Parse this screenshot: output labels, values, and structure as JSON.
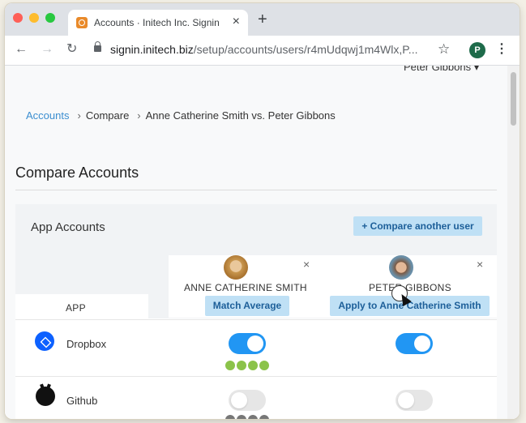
{
  "browser": {
    "tab_title": "Accounts · Initech Inc. Signin ·",
    "tab_close": "×",
    "new_tab": "+",
    "url_host": "signin.initech.biz",
    "url_path": "/setup/accounts/users/r4mUdqwj1m4Wlx,P...",
    "back": "←",
    "forward": "→",
    "reload": "↻",
    "bookmark": "☆",
    "profile_initial": "P",
    "menu": "⋮"
  },
  "header": {
    "user_menu": "Peter Gibbons ▾"
  },
  "breadcrumb": {
    "items": [
      "Accounts",
      "Compare",
      "Anne Catherine Smith vs. Peter Gibbons"
    ],
    "separator": "›"
  },
  "page": {
    "title": "Compare Accounts"
  },
  "panel": {
    "heading": "App Accounts",
    "compare_button": "+ Compare another user",
    "app_column_header": "APP"
  },
  "users": [
    {
      "name": "ANNE CATHERINE SMITH",
      "action": "Match Average",
      "remove": "×"
    },
    {
      "name": "PETER GIBBONS",
      "action": "Apply to Anne Catherine Smith",
      "remove": "×"
    }
  ],
  "apps": [
    {
      "name": "Dropbox",
      "icon": "dropbox-icon",
      "access": [
        true,
        true
      ],
      "usage_dots": 4,
      "dot_color": "#8bc34a"
    },
    {
      "name": "Github",
      "icon": "github-icon",
      "access": [
        false,
        false
      ],
      "usage_dots": 4,
      "dot_color": "#777777"
    }
  ],
  "colors": {
    "link": "#3b8ed0",
    "button_bg": "#bfe0f5",
    "button_text": "#1d5f99",
    "toggle_on": "#2196f3"
  }
}
